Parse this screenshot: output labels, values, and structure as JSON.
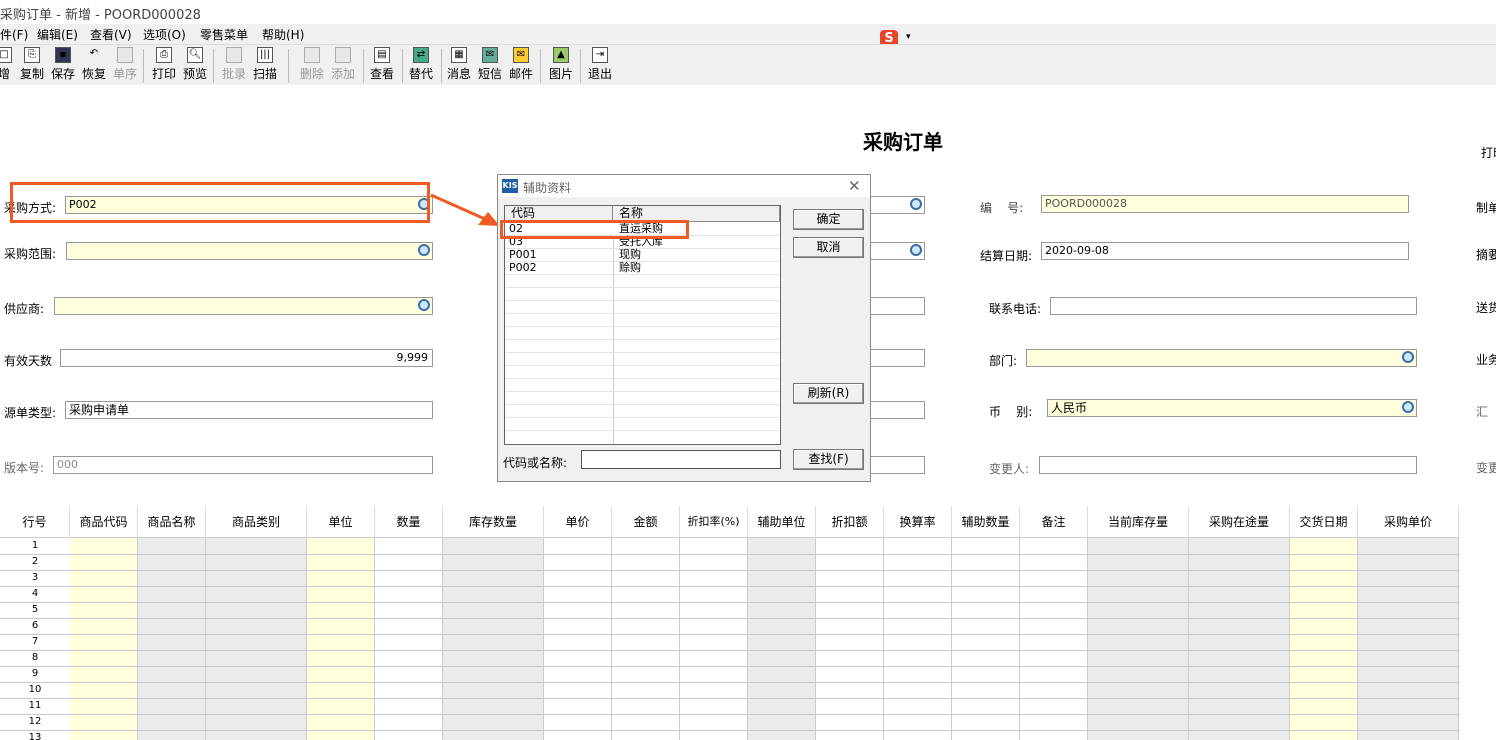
{
  "window": {
    "title": "采购订单 - 新增 - POORD000028"
  },
  "menubar": {
    "items": [
      "件(F)",
      "编辑(E)",
      "查看(V)",
      "选项(O)",
      "零售菜单",
      "帮助(H)"
    ]
  },
  "ime": {
    "label": "S"
  },
  "toolbar": {
    "new": "增",
    "copy": "复制",
    "save": "保存",
    "restore": "恢复",
    "sequence": "单序",
    "print": "打印",
    "preview": "预览",
    "batch": "批录",
    "scan": "扫描",
    "delete": "删除",
    "add": "添加",
    "view": "查看",
    "replace": "替代",
    "message": "消息",
    "sms": "短信",
    "mail": "邮件",
    "picture": "图片",
    "exit": "退出"
  },
  "form": {
    "title": "采购订单",
    "print_label": "打印",
    "purchase_method": {
      "label": "采购方式:",
      "value": "P002"
    },
    "purchase_scope": {
      "label": "采购范围:",
      "value": ""
    },
    "supplier": {
      "label": "供应商:",
      "value": ""
    },
    "valid_days": {
      "label": "有效天数",
      "value": "9,999"
    },
    "source_type": {
      "label": "源单类型:",
      "value": "采购申请单"
    },
    "version": {
      "label": "版本号:",
      "value": "000"
    },
    "number": {
      "label": "编    号:",
      "value": "POORD000028"
    },
    "settle_date": {
      "label": "结算日期:",
      "value": "2020-09-08"
    },
    "phone": {
      "label": "联系电话:",
      "value": ""
    },
    "dept": {
      "label": "部门:",
      "value": ""
    },
    "currency": {
      "label": "币    别:",
      "value": "人民币"
    },
    "changer": {
      "label": "变更人:",
      "value": ""
    },
    "right_labels": [
      "制单",
      "摘要",
      "送货",
      "业务",
      "汇",
      "变更"
    ]
  },
  "dialog": {
    "title": "辅助资料",
    "col_code": "代码",
    "col_name": "名称",
    "rows": [
      {
        "code": "02",
        "name": "直运采购"
      },
      {
        "code": "03",
        "name": "受托入库"
      },
      {
        "code": "P001",
        "name": "现购"
      },
      {
        "code": "P002",
        "name": "赊购"
      }
    ],
    "ok": "确定",
    "cancel": "取消",
    "refresh": "刷新(R)",
    "find": "查找(F)",
    "search_label": "代码或名称:",
    "search_value": ""
  },
  "table": {
    "headers": [
      "行号",
      "商品代码",
      "商品名称",
      "商品类别",
      "单位",
      "数量",
      "库存数量",
      "单价",
      "金额",
      "折扣率(%)",
      "辅助单位",
      "折扣额",
      "换算率",
      "辅助数量",
      "备注",
      "当前库存量",
      "采购在途量",
      "交货日期",
      "采购单价"
    ],
    "rows": [
      "1",
      "2",
      "3",
      "4",
      "5",
      "6",
      "7",
      "8",
      "9",
      "10",
      "11",
      "12",
      "13"
    ]
  },
  "colors": {
    "highlight": "#f05a23",
    "required_field": "#ffffdd",
    "readonly_col": "#ebebeb"
  }
}
